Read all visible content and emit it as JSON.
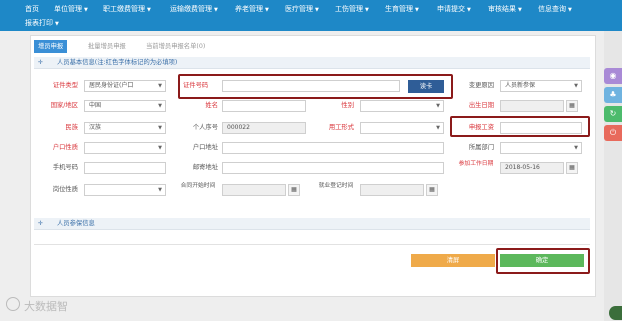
{
  "nav": {
    "items": [
      {
        "label": "首页",
        "caret": ""
      },
      {
        "label": "单位管理",
        "caret": "▼"
      },
      {
        "label": "职工缴费管理",
        "caret": "▼"
      },
      {
        "label": "运输缴费管理",
        "caret": "▼"
      },
      {
        "label": "养老管理",
        "caret": "▼"
      },
      {
        "label": "医疗管理",
        "caret": "▼"
      },
      {
        "label": "工伤管理",
        "caret": "▼"
      },
      {
        "label": "生育管理",
        "caret": "▼"
      },
      {
        "label": "申请提交",
        "caret": "▼"
      },
      {
        "label": "审核结果",
        "caret": "▼"
      },
      {
        "label": "信息查询",
        "caret": "▼"
      },
      {
        "label": "报表打印",
        "caret": "▼"
      }
    ]
  },
  "tabs": [
    "增员申报",
    "批量增员申报",
    "当前增员申报名单(0)"
  ],
  "section1": {
    "title": "人员基本信息(注:红色字体标记的为必填项)"
  },
  "section2": {
    "title": "人员参保信息"
  },
  "form": {
    "cert_type_label": "证件类型",
    "cert_type_value": "居民身份证(户口",
    "cert_no_label": "证件号码",
    "cert_no_value": "",
    "read_card": "读卡",
    "change_reason_label": "变更原因",
    "change_reason_value": "人员新参保",
    "country_label": "国家/地区",
    "country_value": "中国",
    "name_label": "姓名",
    "gender_label": "性别",
    "birth_label": "出生日期",
    "ethnic_label": "民族",
    "ethnic_value": "汉族",
    "personal_no_label": "个人序号",
    "personal_no_value": "000022",
    "emp_form_label": "用工形式",
    "declared_wage_label": "申报工资",
    "hukou_nature_label": "户口性质",
    "hukou_addr_label": "户口地址",
    "dept_label": "所属部门",
    "phone_label": "手机号码",
    "mail_addr_label": "邮寄地址",
    "work_date_label": "参加工作日期",
    "work_date_value": "2018-05-16",
    "post_nature_label": "岗位性质",
    "contract_start_label": "合同开始时间",
    "reemploy_label": "就业登记时间",
    "cal_icon": "▦"
  },
  "buttons": {
    "clear": "清屏",
    "confirm": "确定"
  },
  "side_icons": [
    "eye-icon",
    "tree-icon",
    "refresh-icon",
    "power-icon"
  ],
  "side_glyphs": [
    "◉",
    "♣",
    "↻",
    "⏻"
  ],
  "watermark": "大数据智"
}
